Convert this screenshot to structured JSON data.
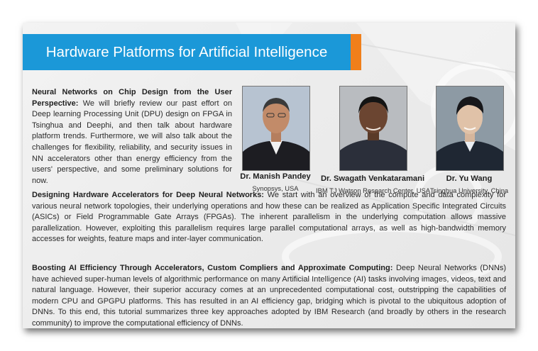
{
  "header": {
    "title": "Hardware Platforms for Artificial Intelligence"
  },
  "sections": [
    {
      "heading": "Neural Networks on Chip Design from the User Perspective:",
      "body": "We will briefly review our past effort on Deep learning Processing Unit (DPU) design on FPGA in Tsinghua and Deephi, and then talk about hardware platform trends. Furthermore, we will also talk about the challenges for flexibility, reliability, and security issues in NN accelerators other than energy efficiency from the users' perspective, and some preliminary solutions for now."
    },
    {
      "heading": "Designing Hardware Accelerators for Deep Neural Networks:",
      "body": "We start with an overview of the compute and data complexity for various neural network topologies, their underlying operations and how these can be realized as Application Specific Integrated Circuits (ASICs) or Field Programmable Gate Arrays (FPGAs). The inherent parallelism in the underlying computation allows massive parallelization. However, exploiting this parallelism requires large parallel computational arrays, as well as high-bandwidth memory accesses for weights, feature maps and inter-layer communication."
    },
    {
      "heading": "Boosting AI Efficiency Through Accelerators, Custom Compliers and Approximate Computing:",
      "body": "Deep Neural Networks (DNNs) have achieved super-human levels of algorithmic performance on many Artificial Intelligence (AI) tasks involving images, videos, text and natural language. However, their superior accuracy comes at an unprecedented computational cost, outstripping the capabilities of modern CPU and GPGPU platforms. This has resulted in an AI efficiency gap, bridging which is pivotal to the ubiquitous adoption of DNNs. To this end, this tutorial summarizes three key approaches adopted by IBM Research (and broadly by others in the research community) to improve the computational efficiency of DNNs."
    }
  ],
  "speakers": [
    {
      "name": "Dr. Manish Pandey",
      "affiliation": "Synopsys, USA"
    },
    {
      "name": "Dr. Swagath Venkataramani",
      "affiliation": "IBM TJ Watson Research Center, USA"
    },
    {
      "name": "Dr. Yu Wang",
      "affiliation": "Tsinghua University, China"
    }
  ],
  "colors": {
    "banner": "#1b98d8",
    "accent": "#f07f1a"
  }
}
